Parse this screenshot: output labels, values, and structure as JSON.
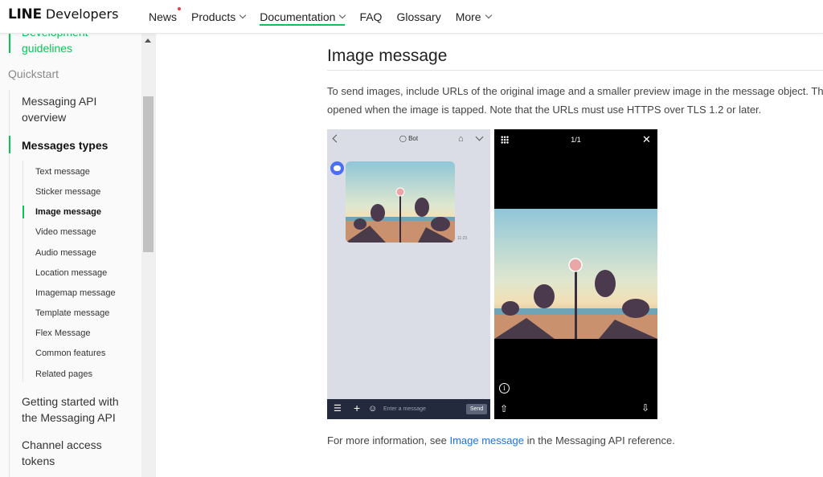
{
  "header": {
    "logo_line": "LINE",
    "logo_developers": "Developers",
    "nav": {
      "news": "News",
      "products": "Products",
      "documentation": "Documentation",
      "faq": "FAQ",
      "glossary": "Glossary",
      "more": "More"
    }
  },
  "sidebar": {
    "development_guidelines_1": "Development",
    "development_guidelines_2": "guidelines",
    "quickstart": "Quickstart",
    "messaging_api_overview_1": "Messaging API",
    "messaging_api_overview_2": "overview",
    "messages_types": "Messages types",
    "sub_items": [
      "Text message",
      "Sticker message",
      "Image message",
      "Video message",
      "Audio message",
      "Location message",
      "Imagemap message",
      "Template message",
      "Flex Message",
      "Common features",
      "Related pages"
    ],
    "getting_started_1": "Getting started with",
    "getting_started_2": "the Messaging API",
    "channel_access_1": "Channel access",
    "channel_access_2": "tokens"
  },
  "main": {
    "title": "Image message",
    "para_line1": "To send images, include URLs of the original image and a smaller preview image in the message object. Th",
    "para_line2": "opened when the image is tapped. Note that the URLs must use HTTPS over TLS 1.2 or later.",
    "more_info_prefix": "For more information, see ",
    "more_info_link": "Image message",
    "more_info_suffix": " in the Messaging API reference."
  },
  "phone_left": {
    "bot_name": "Bot",
    "timestamp": "11:23",
    "input_placeholder": "Enter a message",
    "send_label": "Send"
  },
  "phone_right": {
    "page_count": "1/1"
  },
  "colors": {
    "brand_green": "#06c755",
    "link_blue": "#1a73d9",
    "news_dot_red": "#f03c3c"
  }
}
